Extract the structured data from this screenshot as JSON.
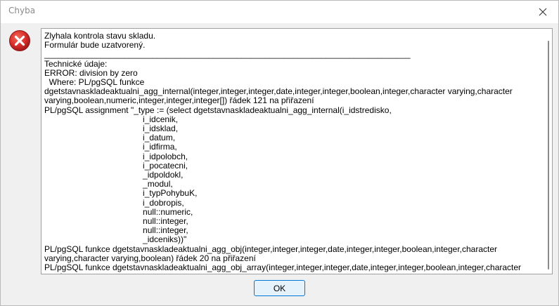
{
  "window": {
    "title": "Chyba"
  },
  "icons": {
    "close": "close-icon",
    "error": "error-icon"
  },
  "colors": {
    "error_red": "#d9302b",
    "button_border": "#0078d4",
    "button_bg": "#e5f1fb"
  },
  "message": {
    "text": "Zlyhala kontrola stavu skladu.\nFormulár bude uzatvorený.\n______________________________________________________________________________\nTechnické údaje:\nERROR: division by zero\n  Where: PL/pgSQL funkce dgetstavnaskladeaktualni_agg_internal(integer,integer,integer,date,integer,integer,boolean,integer,character varying,character varying,boolean,numeric,integer,integer,integer[]) řádek 121 na přiřazení\nPL/pgSQL assignment \"_type := (select dgetstavnaskladeaktualni_agg_internal(i_idstredisko,\n                                          i_idcenik,\n                                          i_idsklad,\n                                          i_datum,\n                                          i_idfirma,\n                                          i_idpolobch,\n                                          i_pocatecni,\n                                          _idpoldokl,\n                                          _modul,\n                                          i_typPohybuK,\n                                          i_dobropis,\n                                          null::numeric,\n                                          null::integer,\n                                          null::integer,\n                                          _idceniks))\"\nPL/pgSQL funkce dgetstavnaskladeaktualni_agg_obj(integer,integer,integer,date,integer,integer,boolean,integer,character varying,character varying,boolean) řádek 20 na přiřazení\nPL/pgSQL funkce dgetstavnaskladeaktualni_agg_obj_array(integer,integer,integer,date,integer,integer,boolean,integer,character varying"
  },
  "buttons": {
    "ok": "OK"
  }
}
